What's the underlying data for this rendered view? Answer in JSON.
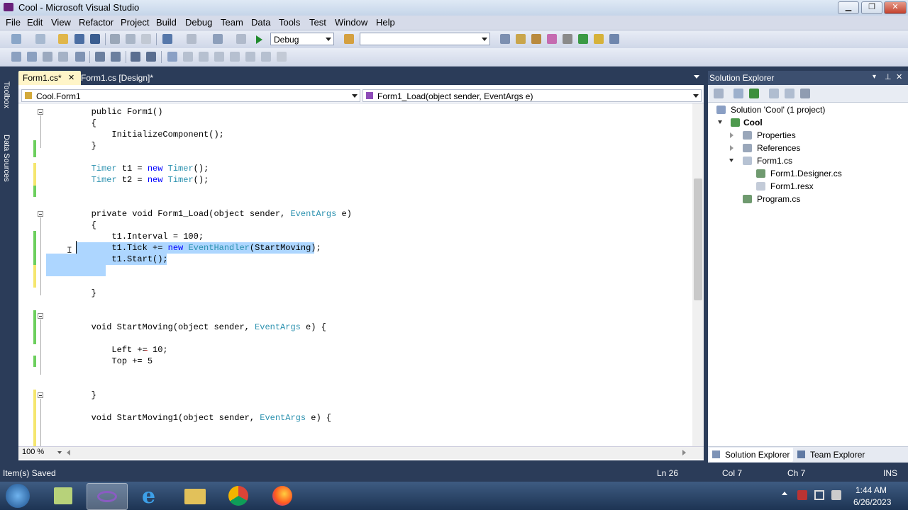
{
  "window": {
    "title": "Cool - Microsoft Visual Studio",
    "controls": {
      "minimize": "▁",
      "maximize": "❐",
      "close": "✕"
    }
  },
  "menu": [
    "File",
    "Edit",
    "View",
    "Refactor",
    "Project",
    "Build",
    "Debug",
    "Team",
    "Data",
    "Tools",
    "Test",
    "Window",
    "Help"
  ],
  "toolbar": {
    "config_value": "Debug",
    "platform_value": ""
  },
  "left_strip": {
    "toolbox": "Toolbox",
    "data_sources": "Data Sources"
  },
  "doc_tabs": [
    {
      "label": "Form1.cs*",
      "active": true
    },
    {
      "label": "Form1.cs [Design]*",
      "active": false
    }
  ],
  "nav": {
    "class_combo": "Cool.Form1",
    "member_combo": "Form1_Load(object sender, EventArgs e)"
  },
  "code_lines": [
    [
      [
        "",
        "        public Form1()"
      ]
    ],
    [
      [
        "",
        "        {"
      ]
    ],
    [
      [
        "",
        "            InitializeComponent();"
      ]
    ],
    [
      [
        "",
        "        }"
      ]
    ],
    [
      [
        "",
        ""
      ]
    ],
    [
      [
        "ty",
        "        Timer"
      ],
      [
        "",
        " t1 = "
      ],
      [
        "kw",
        "new"
      ],
      [
        "ty",
        " Timer"
      ],
      [
        "",
        "();"
      ]
    ],
    [
      [
        "ty",
        "        Timer"
      ],
      [
        "",
        " t2 = "
      ],
      [
        "kw",
        "new"
      ],
      [
        "ty",
        " Timer"
      ],
      [
        "",
        "();"
      ]
    ],
    [
      [
        "",
        ""
      ]
    ],
    [
      [
        "",
        ""
      ]
    ],
    [
      [
        "",
        "        private void Form1_Load(object sender, "
      ],
      [
        "ty",
        "EventArgs"
      ],
      [
        "",
        " e)"
      ]
    ],
    [
      [
        "",
        "        {"
      ]
    ],
    [
      [
        "",
        "            t1.Interval = 100;"
      ]
    ],
    [
      [
        "",
        "            t1.Tick += "
      ],
      [
        "kw",
        "new"
      ],
      [
        "ty",
        " EventHandler"
      ],
      [
        "",
        "(StartMoving);"
      ]
    ],
    [
      [
        "",
        "            t1.Start();"
      ]
    ],
    [
      [
        "",
        ""
      ]
    ],
    [
      [
        "",
        ""
      ]
    ],
    [
      [
        "",
        "        }"
      ]
    ],
    [
      [
        "",
        ""
      ]
    ],
    [
      [
        "",
        ""
      ]
    ],
    [
      [
        "",
        "        void StartMoving(object sender, "
      ],
      [
        "ty",
        "EventArgs"
      ],
      [
        "",
        " e) {"
      ]
    ],
    [
      [
        "",
        ""
      ]
    ],
    [
      [
        "",
        "            Left += 10;"
      ]
    ],
    [
      [
        "",
        "            Top += 5"
      ]
    ],
    [
      [
        "",
        ""
      ]
    ],
    [
      [
        "",
        ""
      ]
    ],
    [
      [
        "",
        "        }"
      ]
    ],
    [
      [
        "",
        ""
      ]
    ],
    [
      [
        "",
        "        void StartMoving1(object sender, "
      ],
      [
        "ty",
        "EventArgs"
      ],
      [
        "",
        " e) {"
      ]
    ],
    [
      [
        "",
        ""
      ]
    ],
    [
      [
        "",
        ""
      ]
    ],
    [
      [
        "",
        ""
      ]
    ],
    [
      [
        "",
        "        }"
      ]
    ]
  ],
  "zoom": "100 %",
  "solution_explorer": {
    "title": "Solution Explorer",
    "items": [
      {
        "label": "Solution 'Cool' (1 project)",
        "icon": "solution-icon"
      },
      {
        "label": "Cool",
        "icon": "csharp-project-icon"
      },
      {
        "label": "Properties",
        "icon": "folder-icon"
      },
      {
        "label": "References",
        "icon": "references-icon"
      },
      {
        "label": "Form1.cs",
        "icon": "form-icon"
      },
      {
        "label": "Form1.Designer.cs",
        "icon": "csharp-file-icon"
      },
      {
        "label": "Form1.resx",
        "icon": "resx-icon"
      },
      {
        "label": "Program.cs",
        "icon": "csharp-file-icon"
      }
    ],
    "bottom_tabs": [
      "Solution Explorer",
      "Team Explorer"
    ]
  },
  "status": {
    "message": "Item(s) Saved",
    "ln": "Ln 26",
    "col": "Col 7",
    "ch": "Ch 7",
    "mode": "INS"
  },
  "taskbar": {
    "time": "1:44 AM",
    "date": "6/26/2023"
  },
  "colors": {
    "keyword": "#0000ff",
    "type": "#2b91af",
    "selection": "#add6ff",
    "chrome": "#2b3c59"
  }
}
